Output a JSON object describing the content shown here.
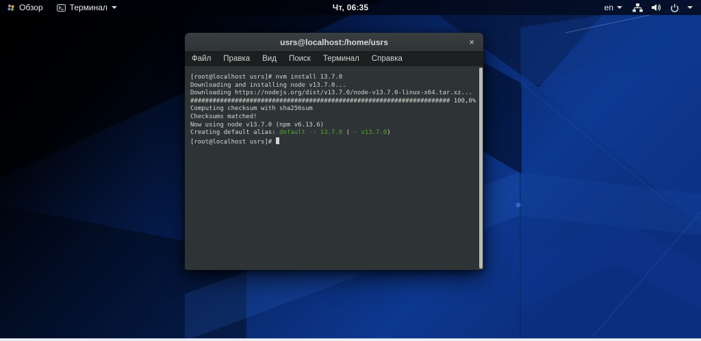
{
  "top_bar": {
    "overview_label": "Обзор",
    "terminal_app_label": "Терминал",
    "clock": "Чт, 06:35",
    "language": "en"
  },
  "window": {
    "title": "usrs@localhost:/home/usrs",
    "close": "×",
    "menu": [
      "Файл",
      "Правка",
      "Вид",
      "Поиск",
      "Терминал",
      "Справка"
    ]
  },
  "terminal_output": {
    "line1": "[root@localhost usrs]# nvm install 13.7.0",
    "line2": "Downloading and installing node v13.7.0...",
    "line3": "Downloading https://nodejs.org/dist/v13.7.0/node-v13.7.0-linux-x64.tar.xz...",
    "line4": "###################################################################### 100,0%",
    "line5": "Computing checksum with sha256sum",
    "line6": "Checksums matched!",
    "line7": "Now using node v13.7.0 (npm v6.13.6)",
    "line8": {
      "prefix": "Creating default alias: ",
      "alias": "default",
      "arrow1": " -> ",
      "version": "13.7.0",
      "paren_open": " (",
      "arrow2": "-> ",
      "resolved": "v13.7.0",
      "paren_close": ")"
    },
    "line9_prompt": "[root@localhost usrs]# "
  },
  "colors": {
    "wallpaper_blue": "#0d3890",
    "terminal_bg": "#2e3436",
    "terminal_fg": "#d3d7cf",
    "titlebar_bg": "#313638",
    "menubar_bg": "#1c1f20",
    "success_green": "#5aa432",
    "dim_arrow": "#4e584e",
    "scrollbar": "#b9bcb9",
    "bottom_strip": "#edf0f5"
  }
}
